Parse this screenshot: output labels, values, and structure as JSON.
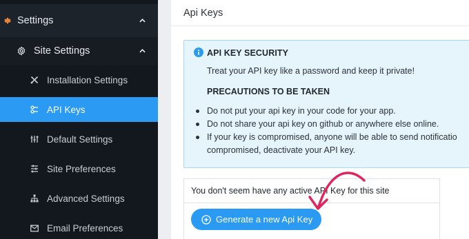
{
  "sidebar": {
    "settings_label": "Settings",
    "site_settings_label": "Site Settings",
    "items": [
      {
        "label": "Installation Settings",
        "icon": "tools-icon",
        "active": false
      },
      {
        "label": "API Keys",
        "icon": "key-icon",
        "active": true
      },
      {
        "label": "Default Settings",
        "icon": "sliders-icon",
        "active": false
      },
      {
        "label": "Site Preferences",
        "icon": "sliders-horizontal-icon",
        "active": false
      },
      {
        "label": "Advanced Settings",
        "icon": "sitemap-icon",
        "active": false
      },
      {
        "label": "Email Preferences",
        "icon": "envelope-icon",
        "active": false
      }
    ]
  },
  "header": {
    "title": "Api Keys"
  },
  "notice": {
    "title": "API KEY SECURITY",
    "text": "Treat your API key like a password and keep it private!",
    "subtitle": "PRECAUTIONS TO BE TAKEN",
    "bullets": [
      "Do not put your api key in your code for your app.",
      "Do not share your api key on github or anywhere else online.",
      "If your key is compromised, anyone will be able to send notificatio"
    ],
    "continuation": "compromised, deactivate your API key."
  },
  "keys": {
    "empty_message": "You don't seem have any active API Key for this site",
    "generate_label": "Generate a new Api Key"
  },
  "colors": {
    "sidebar_bg": "#13181e",
    "accent": "#2b9af3",
    "settings_icon": "#e8833a",
    "notice_bg": "#e6f4fc",
    "arrow": "#e0245e"
  }
}
